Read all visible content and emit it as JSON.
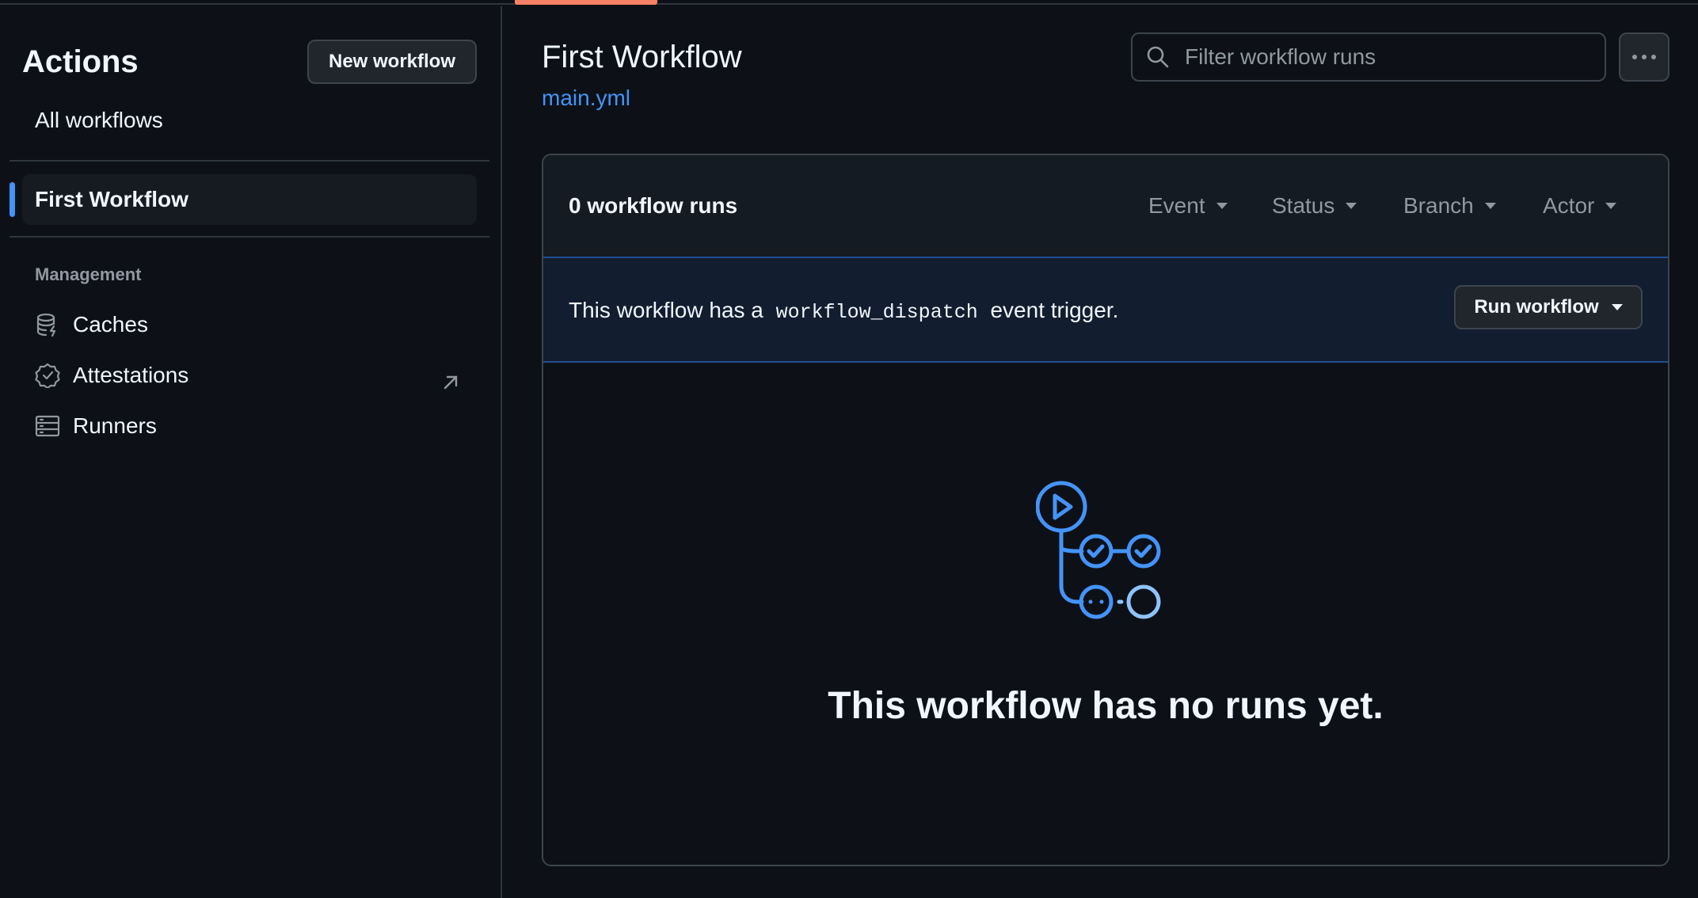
{
  "sidebar": {
    "title": "Actions",
    "new_workflow_label": "New workflow",
    "all_workflows_label": "All workflows",
    "selected_workflow": "First Workflow",
    "management_heading": "Management",
    "items": [
      {
        "label": "Caches",
        "icon": "database-icon"
      },
      {
        "label": "Attestations",
        "icon": "verified-badge-icon",
        "external": true
      },
      {
        "label": "Runners",
        "icon": "server-icon"
      }
    ]
  },
  "header": {
    "title": "First Workflow",
    "file_link": "main.yml",
    "search_placeholder": "Filter workflow runs",
    "more_icon": "kebab-horizontal-icon"
  },
  "runs": {
    "count_label": "0 workflow runs",
    "filters": [
      "Event",
      "Status",
      "Branch",
      "Actor"
    ]
  },
  "dispatch": {
    "text_before": "This workflow has a",
    "code": "workflow_dispatch",
    "text_after": "event trigger.",
    "run_button_label": "Run workflow"
  },
  "empty_state": {
    "message": "This workflow has no runs yet.",
    "icon": "workflow-graph-icon"
  },
  "colors": {
    "background": "#0d1117",
    "accent_link": "#4493f8",
    "tab_underline": "#f78166",
    "border": "#3d444d"
  }
}
